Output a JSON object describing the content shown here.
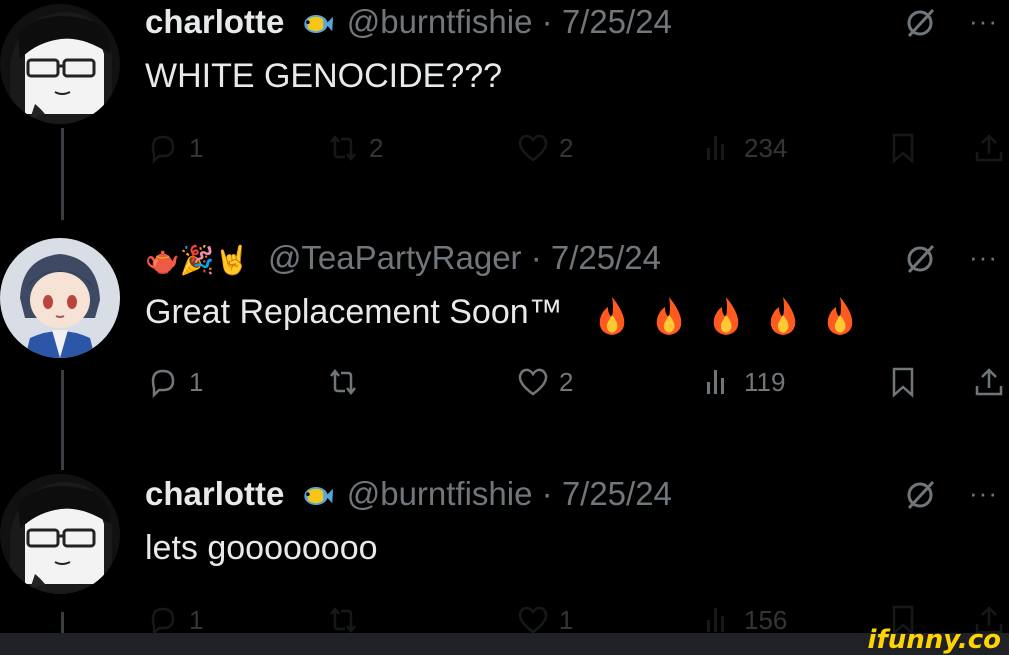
{
  "tweets": [
    {
      "name": "charlotte",
      "handle": "@burntfishie",
      "sep": " · ",
      "date": "7/25/24",
      "text": "WHITE GENOCIDE???",
      "stats": {
        "replies": "1",
        "reposts": "2",
        "likes": "2",
        "views": "234"
      },
      "avatar": "bw-anime-glasses-avatar",
      "badge_icon": "tropical-fish-icon"
    },
    {
      "name": "🫖🎉🤘",
      "handle": "@TeaPartyRager",
      "sep": " · ",
      "date": "7/25/24",
      "text": "Great Replacement Soon™",
      "text_emoji": [
        "fire",
        "fire",
        "fire",
        "fire",
        "fire"
      ],
      "stats": {
        "replies": "1",
        "reposts": "",
        "likes": "2",
        "views": "119"
      },
      "avatar": "anime-figure-avatar"
    },
    {
      "name": "charlotte",
      "handle": "@burntfishie",
      "sep": " · ",
      "date": "7/25/24",
      "text": "lets goooooooo",
      "stats": {
        "replies": "1",
        "reposts": "",
        "likes": "1",
        "views": "156"
      },
      "avatar": "bw-anime-glasses-avatar",
      "badge_icon": "tropical-fish-icon"
    }
  ],
  "watermark": "ifunny.co",
  "colors": {
    "background": "#000000",
    "text": "#e7e9ea",
    "muted": "#71767b",
    "watermark": "#ffd400"
  }
}
